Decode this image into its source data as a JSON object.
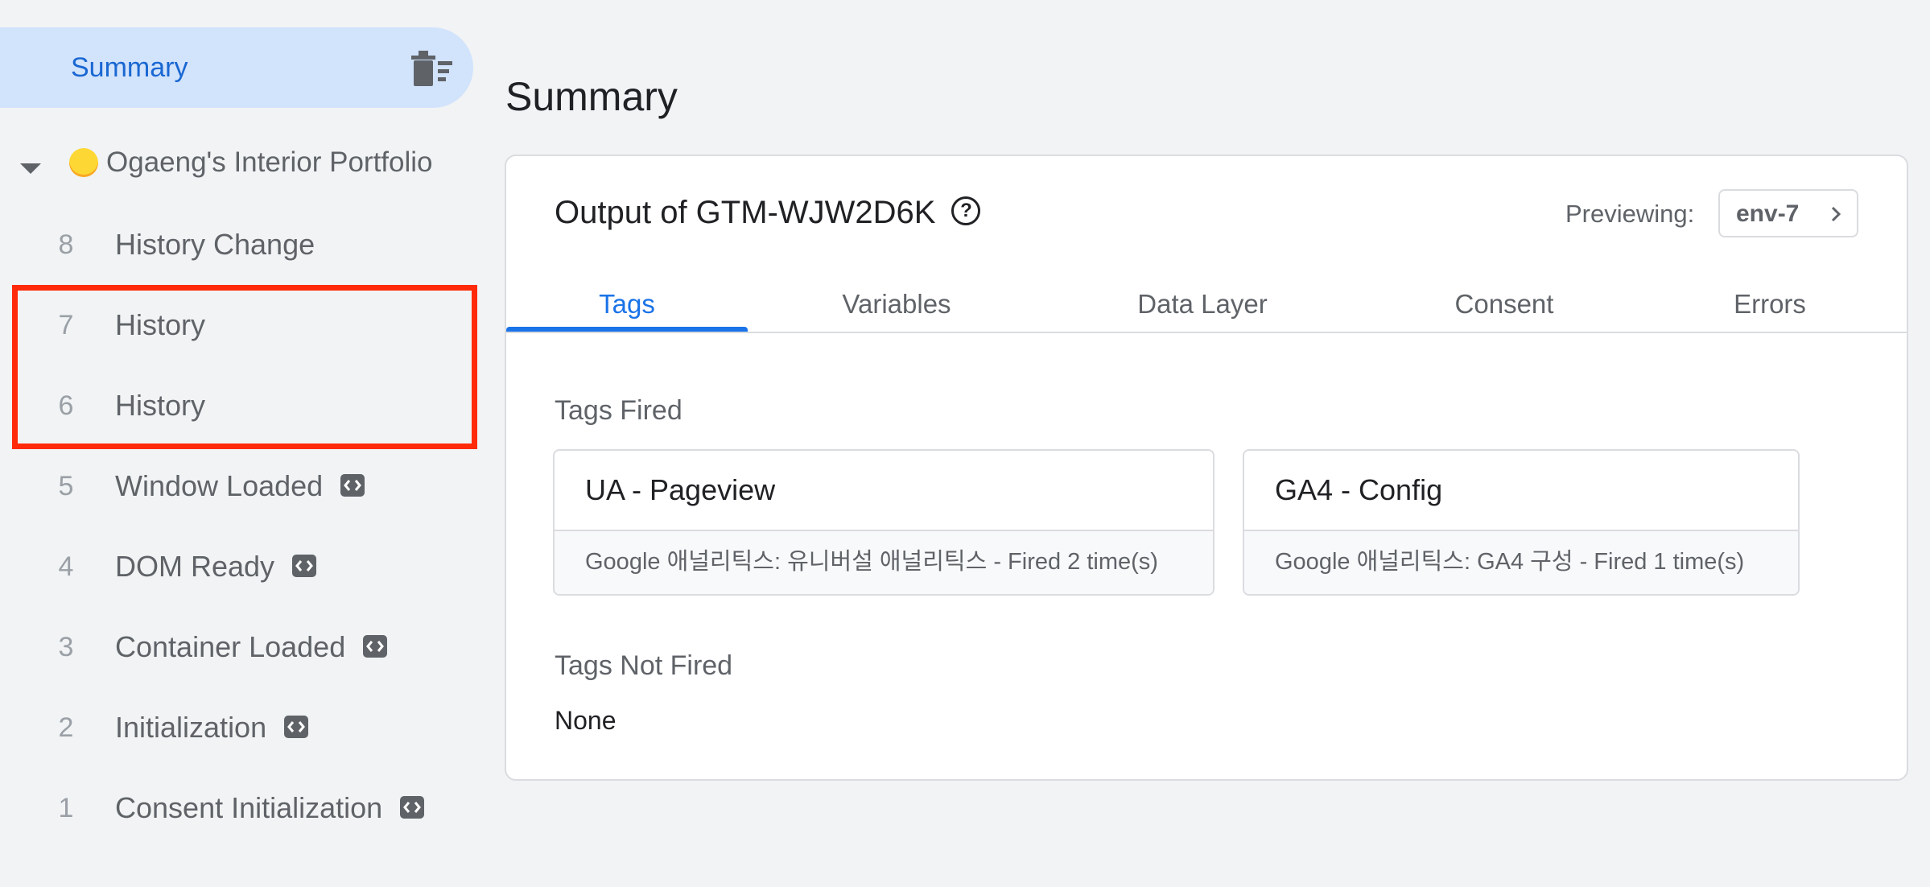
{
  "sidebar": {
    "summary_label": "Summary",
    "container_name": "Ogaeng's Interior Portfolio",
    "events": [
      {
        "num": "8",
        "name": "History Change",
        "has_code_icon": false
      },
      {
        "num": "7",
        "name": "History",
        "has_code_icon": false
      },
      {
        "num": "6",
        "name": "History",
        "has_code_icon": false
      },
      {
        "num": "5",
        "name": "Window Loaded",
        "has_code_icon": true
      },
      {
        "num": "4",
        "name": "DOM Ready",
        "has_code_icon": true
      },
      {
        "num": "3",
        "name": "Container Loaded",
        "has_code_icon": true
      },
      {
        "num": "2",
        "name": "Initialization",
        "has_code_icon": true
      },
      {
        "num": "1",
        "name": "Consent Initialization",
        "has_code_icon": true
      }
    ]
  },
  "main": {
    "title": "Summary",
    "card": {
      "title": "Output of GTM-WJW2D6K",
      "previewing_label": "Previewing:",
      "env": "env-7",
      "tabs": [
        {
          "label": "Tags",
          "active": true
        },
        {
          "label": "Variables",
          "active": false
        },
        {
          "label": "Data Layer",
          "active": false
        },
        {
          "label": "Consent",
          "active": false
        },
        {
          "label": "Errors",
          "active": false
        }
      ],
      "tags_fired_heading": "Tags Fired",
      "tags_fired": [
        {
          "name": "UA - Pageview",
          "detail": "Google 애널리틱스: 유니버설 애널리틱스 - Fired 2 time(s)"
        },
        {
          "name": "GA4 - Config",
          "detail": "Google 애널리틱스: GA4 구성 - Fired 1 time(s)"
        }
      ],
      "tags_not_fired_heading": "Tags Not Fired",
      "tags_not_fired_text": "None"
    }
  },
  "colors": {
    "accent": "#1a73e8",
    "selected_bg": "#d2e3fc",
    "highlight": "#ff2a0a",
    "page_bg": "#f1f3f4"
  },
  "icons": [
    "delete-sweep-icon",
    "caret-down-icon",
    "yellow-dot-icon",
    "code-icon",
    "help-icon",
    "chevron-right-icon"
  ]
}
